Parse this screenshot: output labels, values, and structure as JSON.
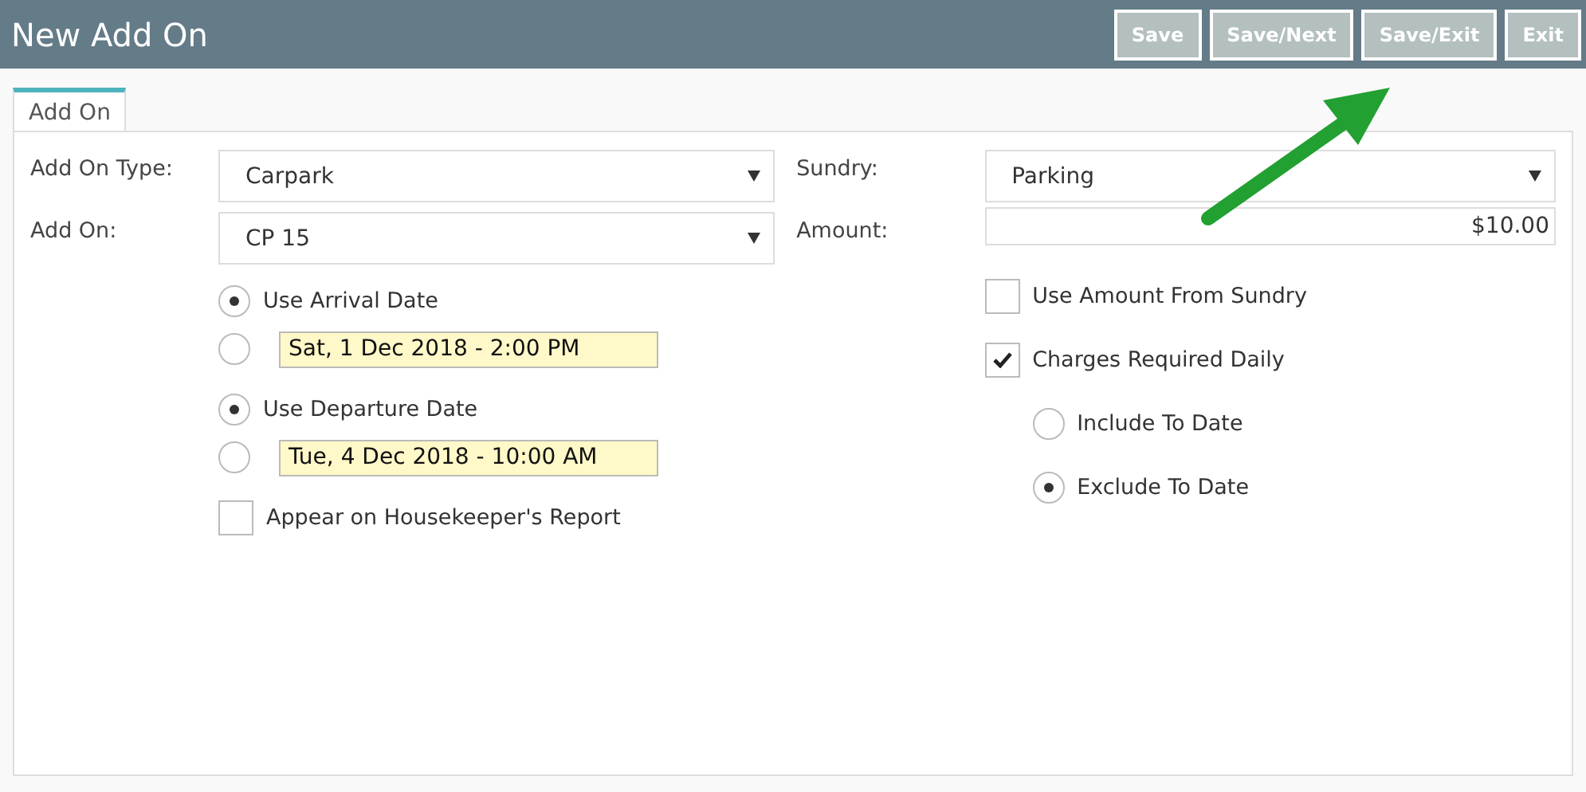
{
  "header": {
    "title": "New Add On",
    "buttons": [
      {
        "label": "Save"
      },
      {
        "label": "Save/Next"
      },
      {
        "label": "Save/Exit"
      },
      {
        "label": "Exit"
      }
    ]
  },
  "tabs": [
    {
      "label": "Add On",
      "selected": true
    }
  ],
  "left": {
    "fields": [
      {
        "label": "Add On Type:",
        "value": "Carpark"
      },
      {
        "label": "Add On:",
        "value": "CP 15"
      }
    ],
    "date_groups": [
      {
        "options": [
          {
            "kind": "label",
            "text": "Use Arrival Date",
            "selected": true
          },
          {
            "kind": "date",
            "text": "Sat, 1 Dec 2018 - 2:00 PM",
            "selected": false
          }
        ]
      },
      {
        "options": [
          {
            "kind": "label",
            "text": "Use Departure Date",
            "selected": true
          },
          {
            "kind": "date",
            "text": "Tue, 4 Dec 2018 - 10:00 AM",
            "selected": false
          }
        ]
      }
    ],
    "checkboxes": [
      {
        "label": "Appear on Housekeeper's Report",
        "checked": false
      }
    ]
  },
  "right": {
    "sundry": {
      "label": "Sundry:",
      "value": "Parking"
    },
    "amount": {
      "label": "Amount:",
      "value": "$10.00"
    },
    "checkboxes": [
      {
        "label": "Use Amount From Sundry",
        "checked": false
      },
      {
        "label": "Charges Required Daily",
        "checked": true
      }
    ],
    "radios": [
      {
        "label": "Include To Date",
        "selected": false
      },
      {
        "label": "Exclude To Date",
        "selected": true
      }
    ]
  }
}
